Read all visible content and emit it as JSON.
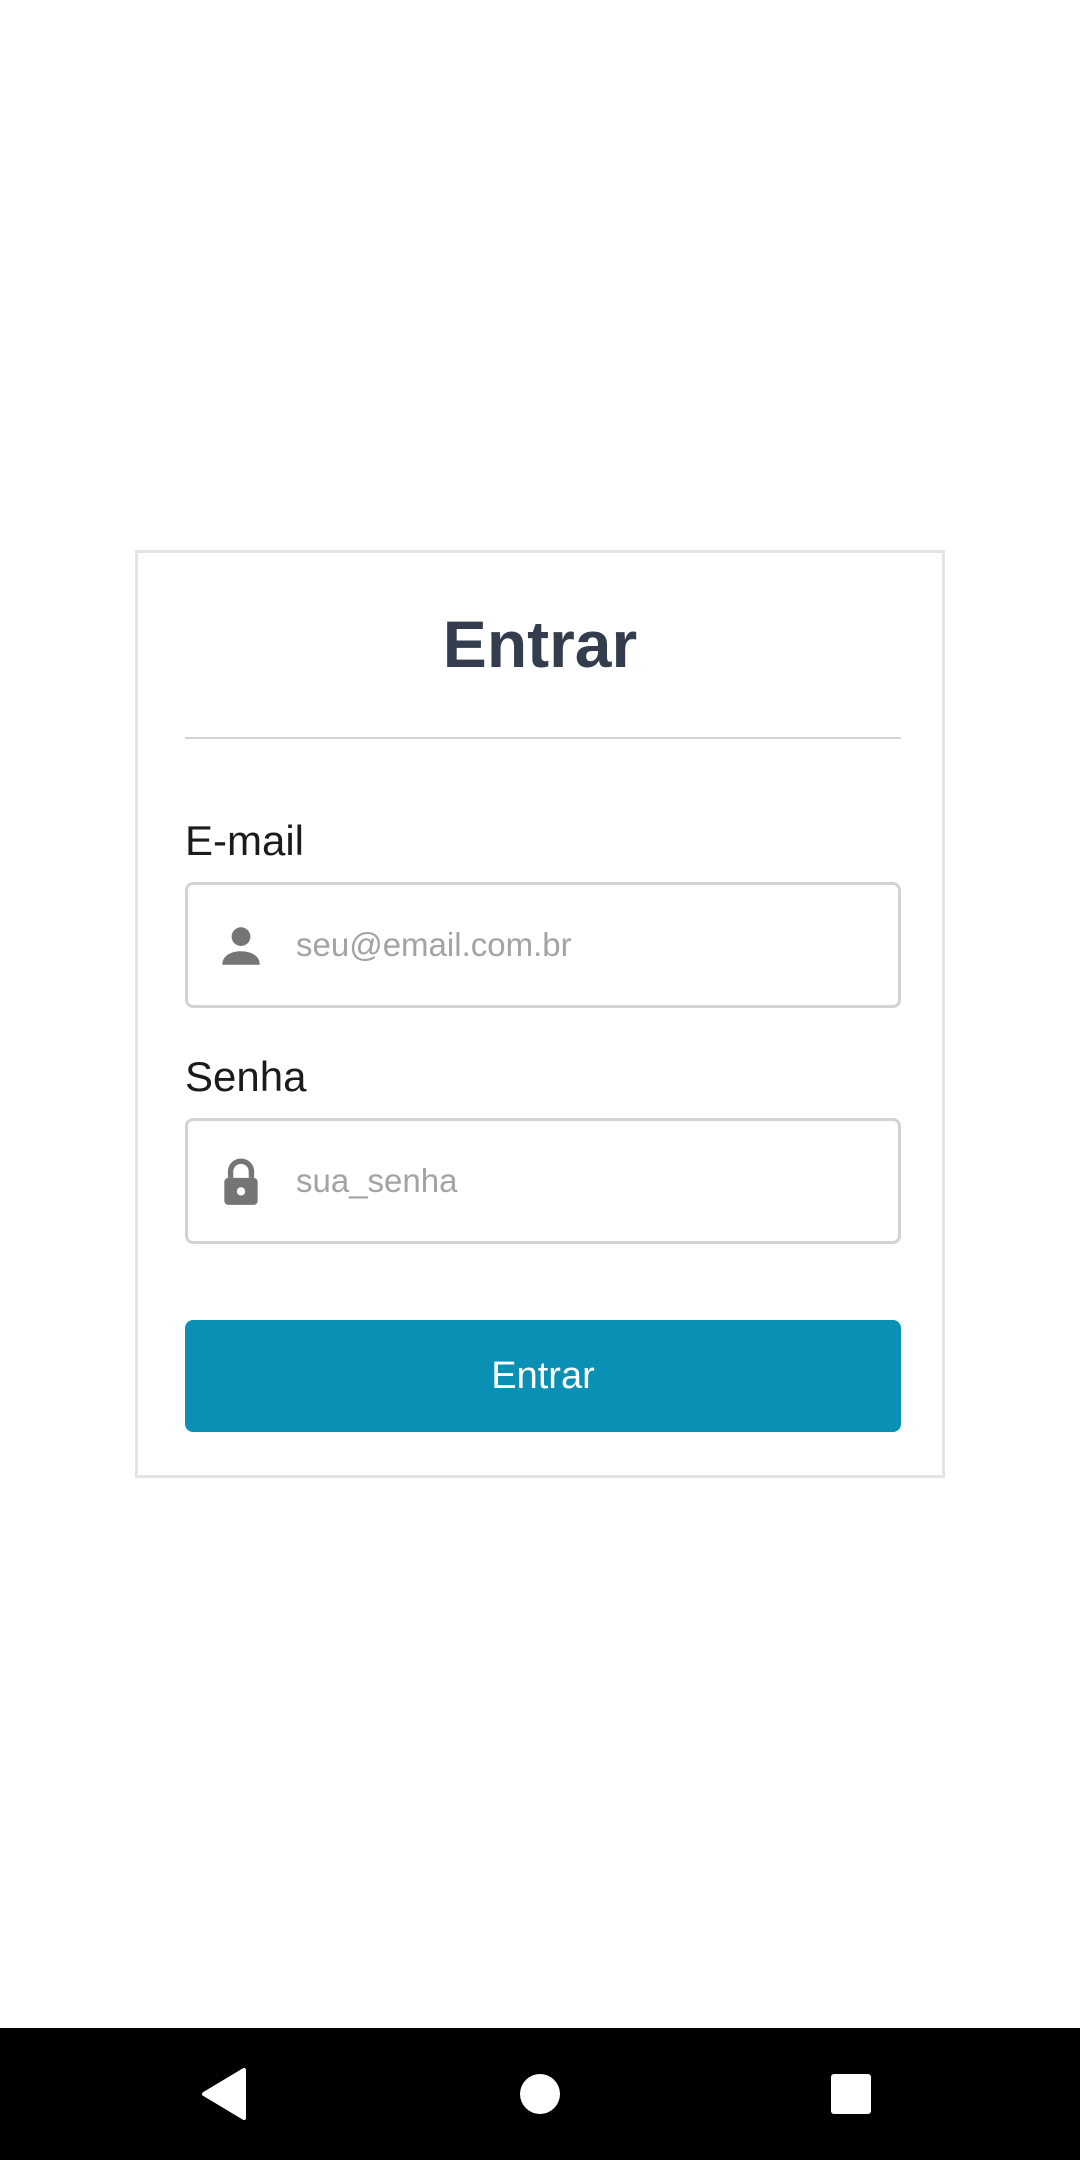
{
  "login": {
    "title": "Entrar",
    "email_label": "E-mail",
    "email_placeholder": "seu@email.com.br",
    "email_icon": "person-icon",
    "password_label": "Senha",
    "password_placeholder": "sua_senha",
    "password_icon": "lock-icon",
    "submit_label": "Entrar",
    "accent_color": "#0990b4",
    "title_color": "#343d4e"
  },
  "navbar": {
    "back_icon": "back-triangle-icon",
    "home_icon": "home-circle-icon",
    "recents_icon": "recents-square-icon"
  }
}
